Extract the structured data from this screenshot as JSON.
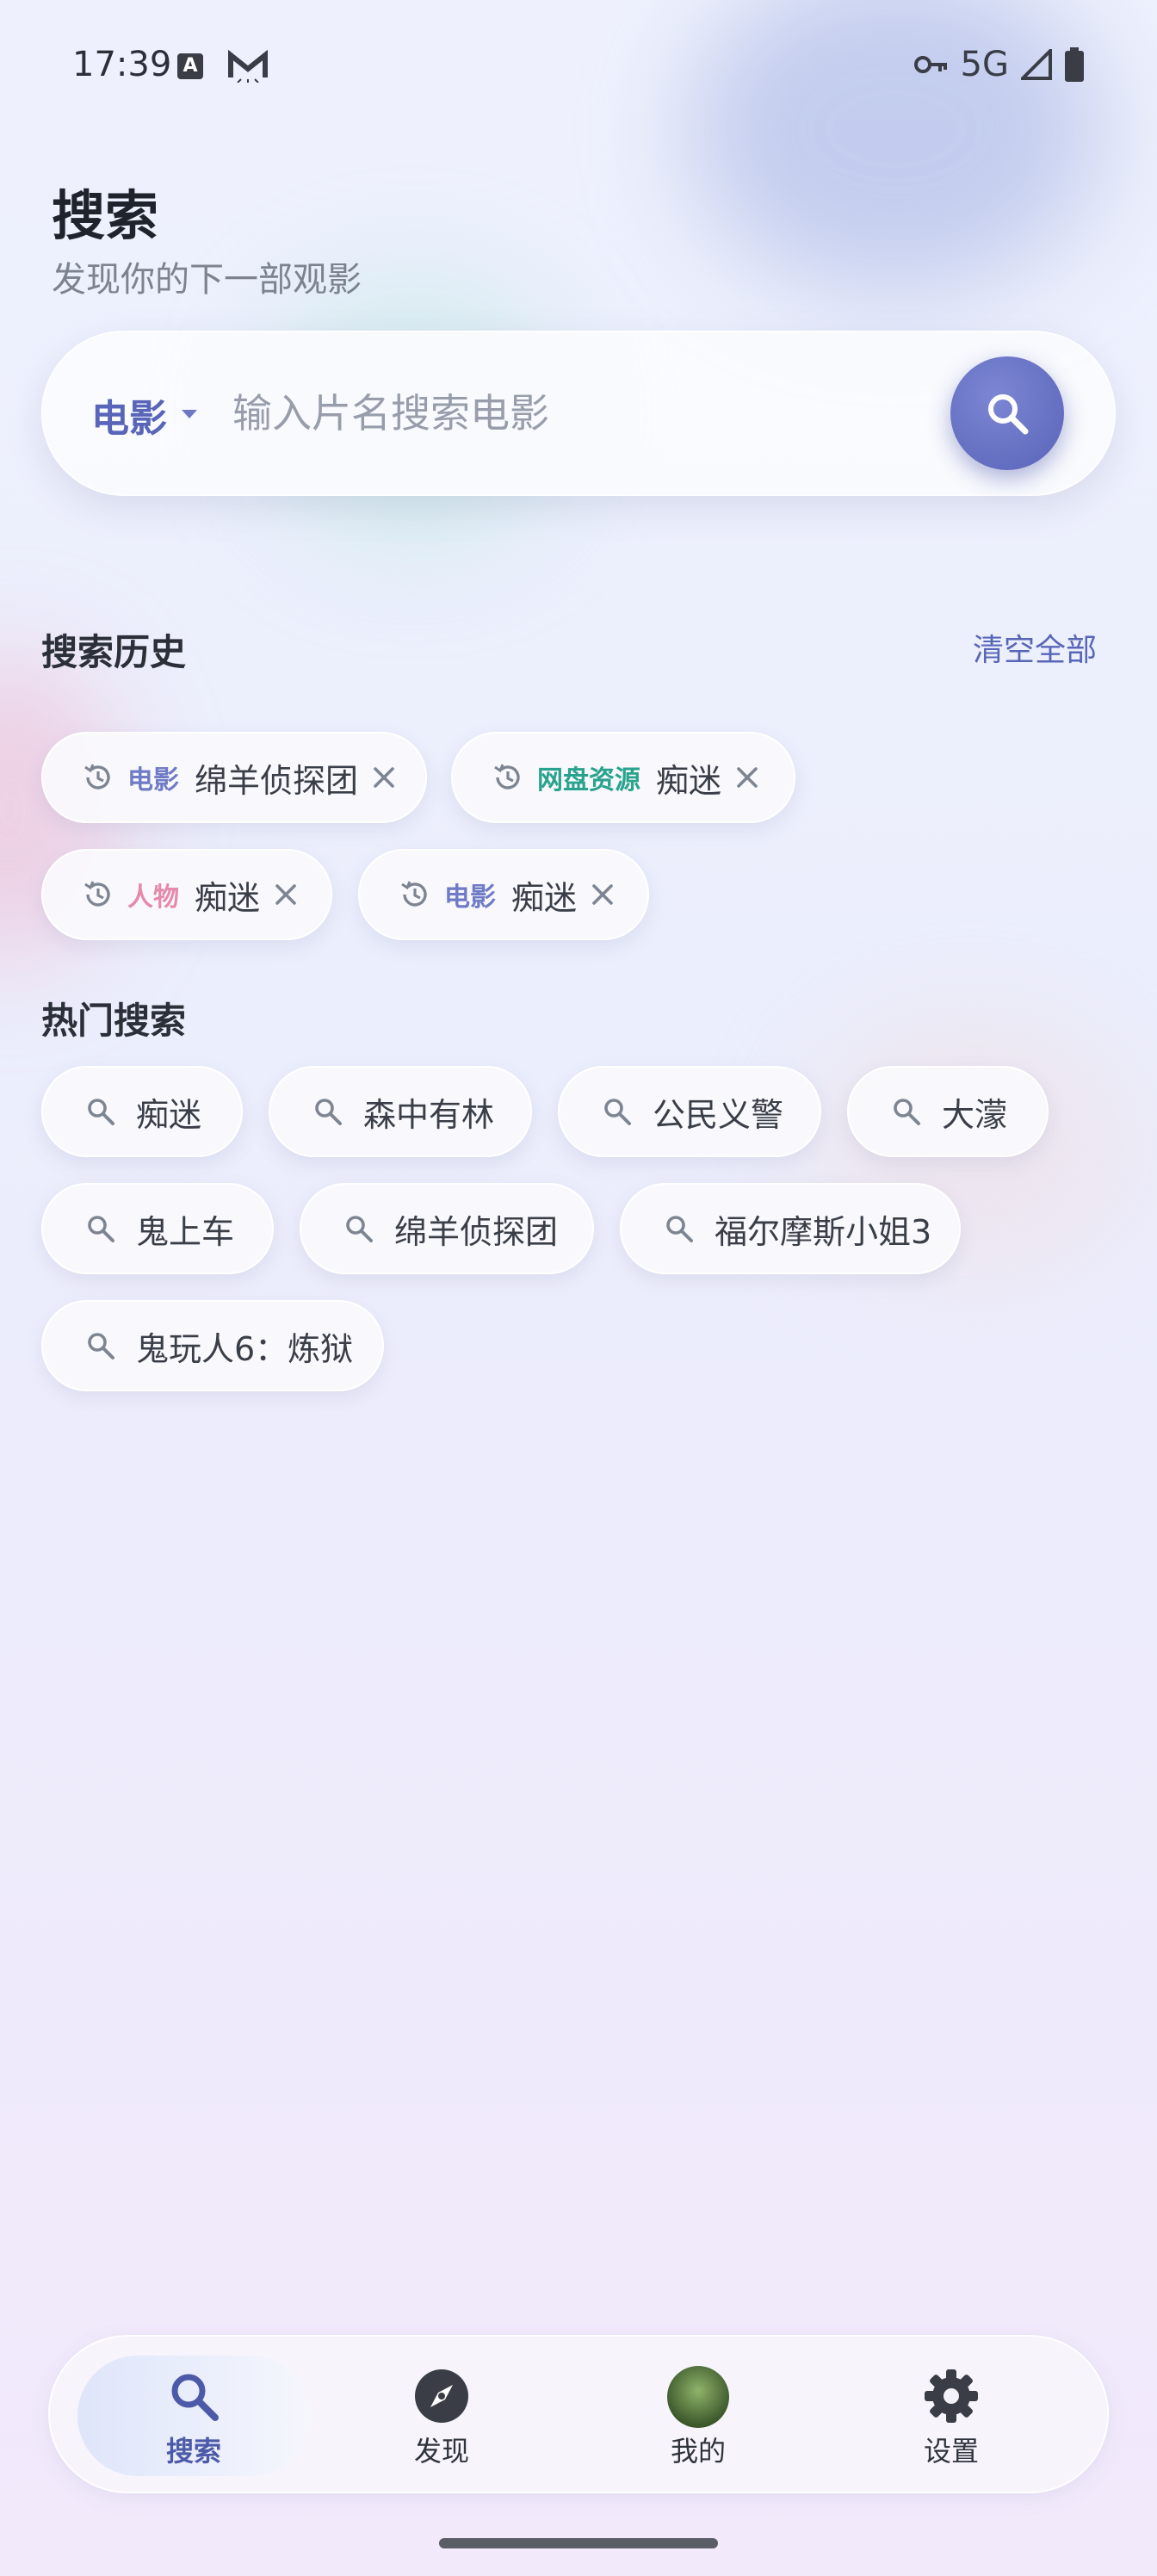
{
  "status_bar": {
    "time": "17:39",
    "network": "5G",
    "icon_a": "A"
  },
  "header": {
    "title": "搜索",
    "subtitle": "发现你的下一部观影"
  },
  "search": {
    "category": "电影",
    "placeholder": "输入片名搜索电影"
  },
  "history": {
    "title": "搜索历史",
    "clear_all": "清空全部",
    "items": [
      {
        "tag": "电影",
        "text": "绵羊侦探团",
        "tag_color": "#6f7bc6"
      },
      {
        "tag": "网盘资源",
        "text": "痴迷",
        "tag_color": "#2aa38e"
      },
      {
        "tag": "人物",
        "text": "痴迷",
        "tag_color": "#e58aa8"
      },
      {
        "tag": "电影",
        "text": "痴迷",
        "tag_color": "#6f7bc6"
      }
    ]
  },
  "hot": {
    "title": "热门搜索",
    "items": [
      "痴迷",
      "森中有林",
      "公民义警",
      "大濛",
      "鬼上车",
      "绵羊侦探团",
      "福尔摩斯小姐3",
      "鬼玩人6：炼狱"
    ]
  },
  "nav": {
    "items": [
      {
        "label": "搜索",
        "icon": "search-icon"
      },
      {
        "label": "发现",
        "icon": "compass-icon"
      },
      {
        "label": "我的",
        "icon": "avatar"
      },
      {
        "label": "设置",
        "icon": "gear-icon"
      }
    ],
    "active": "搜索"
  },
  "colors": {
    "accent": "#5865b8",
    "background": "#eceffc"
  }
}
